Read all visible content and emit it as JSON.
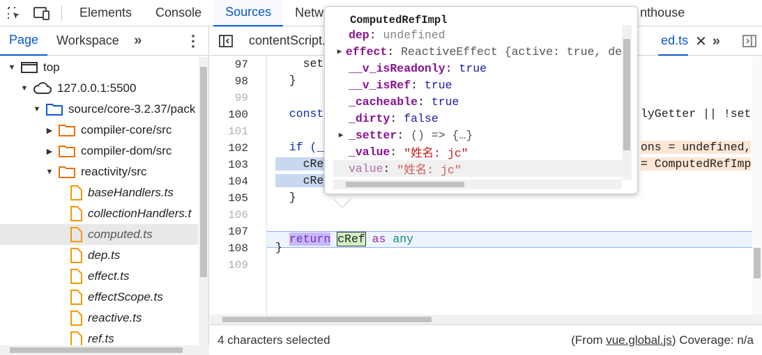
{
  "topbar": {
    "tabs": [
      "Elements",
      "Console",
      "Sources",
      "Netw",
      "nthouse"
    ],
    "active_tab": "Sources"
  },
  "sidebar": {
    "tabs": [
      "Page",
      "Workspace"
    ],
    "tree": [
      {
        "label": "top",
        "icon": "frame-icon",
        "depth": 0,
        "expanded": true
      },
      {
        "label": "127.0.0.1:5500",
        "icon": "cloud-icon",
        "depth": 1,
        "expanded": true
      },
      {
        "label": "source/core-3.2.37/pack",
        "icon": "folder-blue-icon",
        "depth": 2,
        "expanded": true
      },
      {
        "label": "compiler-core/src",
        "icon": "folder-icon",
        "depth": 3,
        "expanded": false
      },
      {
        "label": "compiler-dom/src",
        "icon": "folder-icon",
        "depth": 3,
        "expanded": false
      },
      {
        "label": "reactivity/src",
        "icon": "folder-icon",
        "depth": 3,
        "expanded": true
      },
      {
        "label": "baseHandlers.ts",
        "icon": "file-icon",
        "depth": 4
      },
      {
        "label": "collectionHandlers.t",
        "icon": "file-icon",
        "depth": 4
      },
      {
        "label": "computed.ts",
        "icon": "file-icon",
        "depth": 4,
        "selected": true
      },
      {
        "label": "dep.ts",
        "icon": "file-icon",
        "depth": 4
      },
      {
        "label": "effect.ts",
        "icon": "file-icon",
        "depth": 4
      },
      {
        "label": "effectScope.ts",
        "icon": "file-icon",
        "depth": 4
      },
      {
        "label": "reactive.ts",
        "icon": "file-icon",
        "depth": 4
      },
      {
        "label": "ref.ts",
        "icon": "file-icon",
        "depth": 4
      }
    ]
  },
  "editor": {
    "tabs": {
      "first": "contentScript.",
      "active": "ed.ts"
    },
    "lines": [
      {
        "n": "97",
        "dim": false,
        "text": "    sett"
      },
      {
        "n": "98",
        "dim": false,
        "text": "  }"
      },
      {
        "n": "99",
        "dim": true,
        "text": ""
      },
      {
        "n": "100",
        "dim": false,
        "text": "  const",
        "tail": "lyGetter || !sett"
      },
      {
        "n": "101",
        "dim": true,
        "text": ""
      },
      {
        "n": "102",
        "dim": false,
        "text": "  if (__",
        "tail": "ons = undefined,"
      },
      {
        "n": "103",
        "dim": false,
        "text": "    cRef",
        "tail": "= ComputedRefImp"
      },
      {
        "n": "104",
        "dim": false,
        "text": "    cRef",
        "tail": ""
      },
      {
        "n": "105",
        "dim": false,
        "text": "  }"
      },
      {
        "n": "106",
        "dim": true,
        "text": ""
      },
      {
        "n": "107",
        "dim": false,
        "text": ""
      },
      {
        "n": "108",
        "dim": false,
        "text": "}"
      },
      {
        "n": "109",
        "dim": true,
        "text": ""
      }
    ],
    "return_line": {
      "kw": "return",
      "var": "cRef",
      "as": "as",
      "type": "any"
    }
  },
  "status": {
    "selection": "4 characters selected",
    "from_prefix": "(From ",
    "from_file": "vue.global.js",
    "from_suffix": ") Coverage: n/a"
  },
  "popover": {
    "title": "ComputedRefImpl",
    "rows": [
      {
        "key": "dep",
        "sep": ": ",
        "value": "undefined",
        "vclass": "pv-undef",
        "expandable": false
      },
      {
        "key": "effect",
        "sep": ": ",
        "value": "ReactiveEffect {active: true, de",
        "vclass": "pv-obj",
        "expandable": true
      },
      {
        "key": "__v_isReadonly",
        "sep": ": ",
        "value": "true",
        "vclass": "pv-bool",
        "expandable": false
      },
      {
        "key": "__v_isRef",
        "sep": ": ",
        "value": "true",
        "vclass": "pv-bool",
        "expandable": false
      },
      {
        "key": "_cacheable",
        "sep": ": ",
        "value": "true",
        "vclass": "pv-bool",
        "expandable": false
      },
      {
        "key": "_dirty",
        "sep": ": ",
        "value": "false",
        "vclass": "pv-bool",
        "expandable": false
      },
      {
        "key": "_setter",
        "sep": ": ",
        "value": "() => {…}",
        "vclass": "pv-obj",
        "expandable": true
      },
      {
        "key": "_value",
        "sep": ": ",
        "value": "\"姓名: jc\"",
        "vclass": "pv-str",
        "expandable": false
      },
      {
        "key": "value",
        "sep": ": ",
        "value": "\"姓名: jc\"",
        "vclass": "pv-str",
        "expandable": false,
        "dim": true
      }
    ]
  },
  "colors": {
    "accent": "#0b57d0",
    "folder": "#e8710a",
    "keyword": "#9c27b0"
  }
}
